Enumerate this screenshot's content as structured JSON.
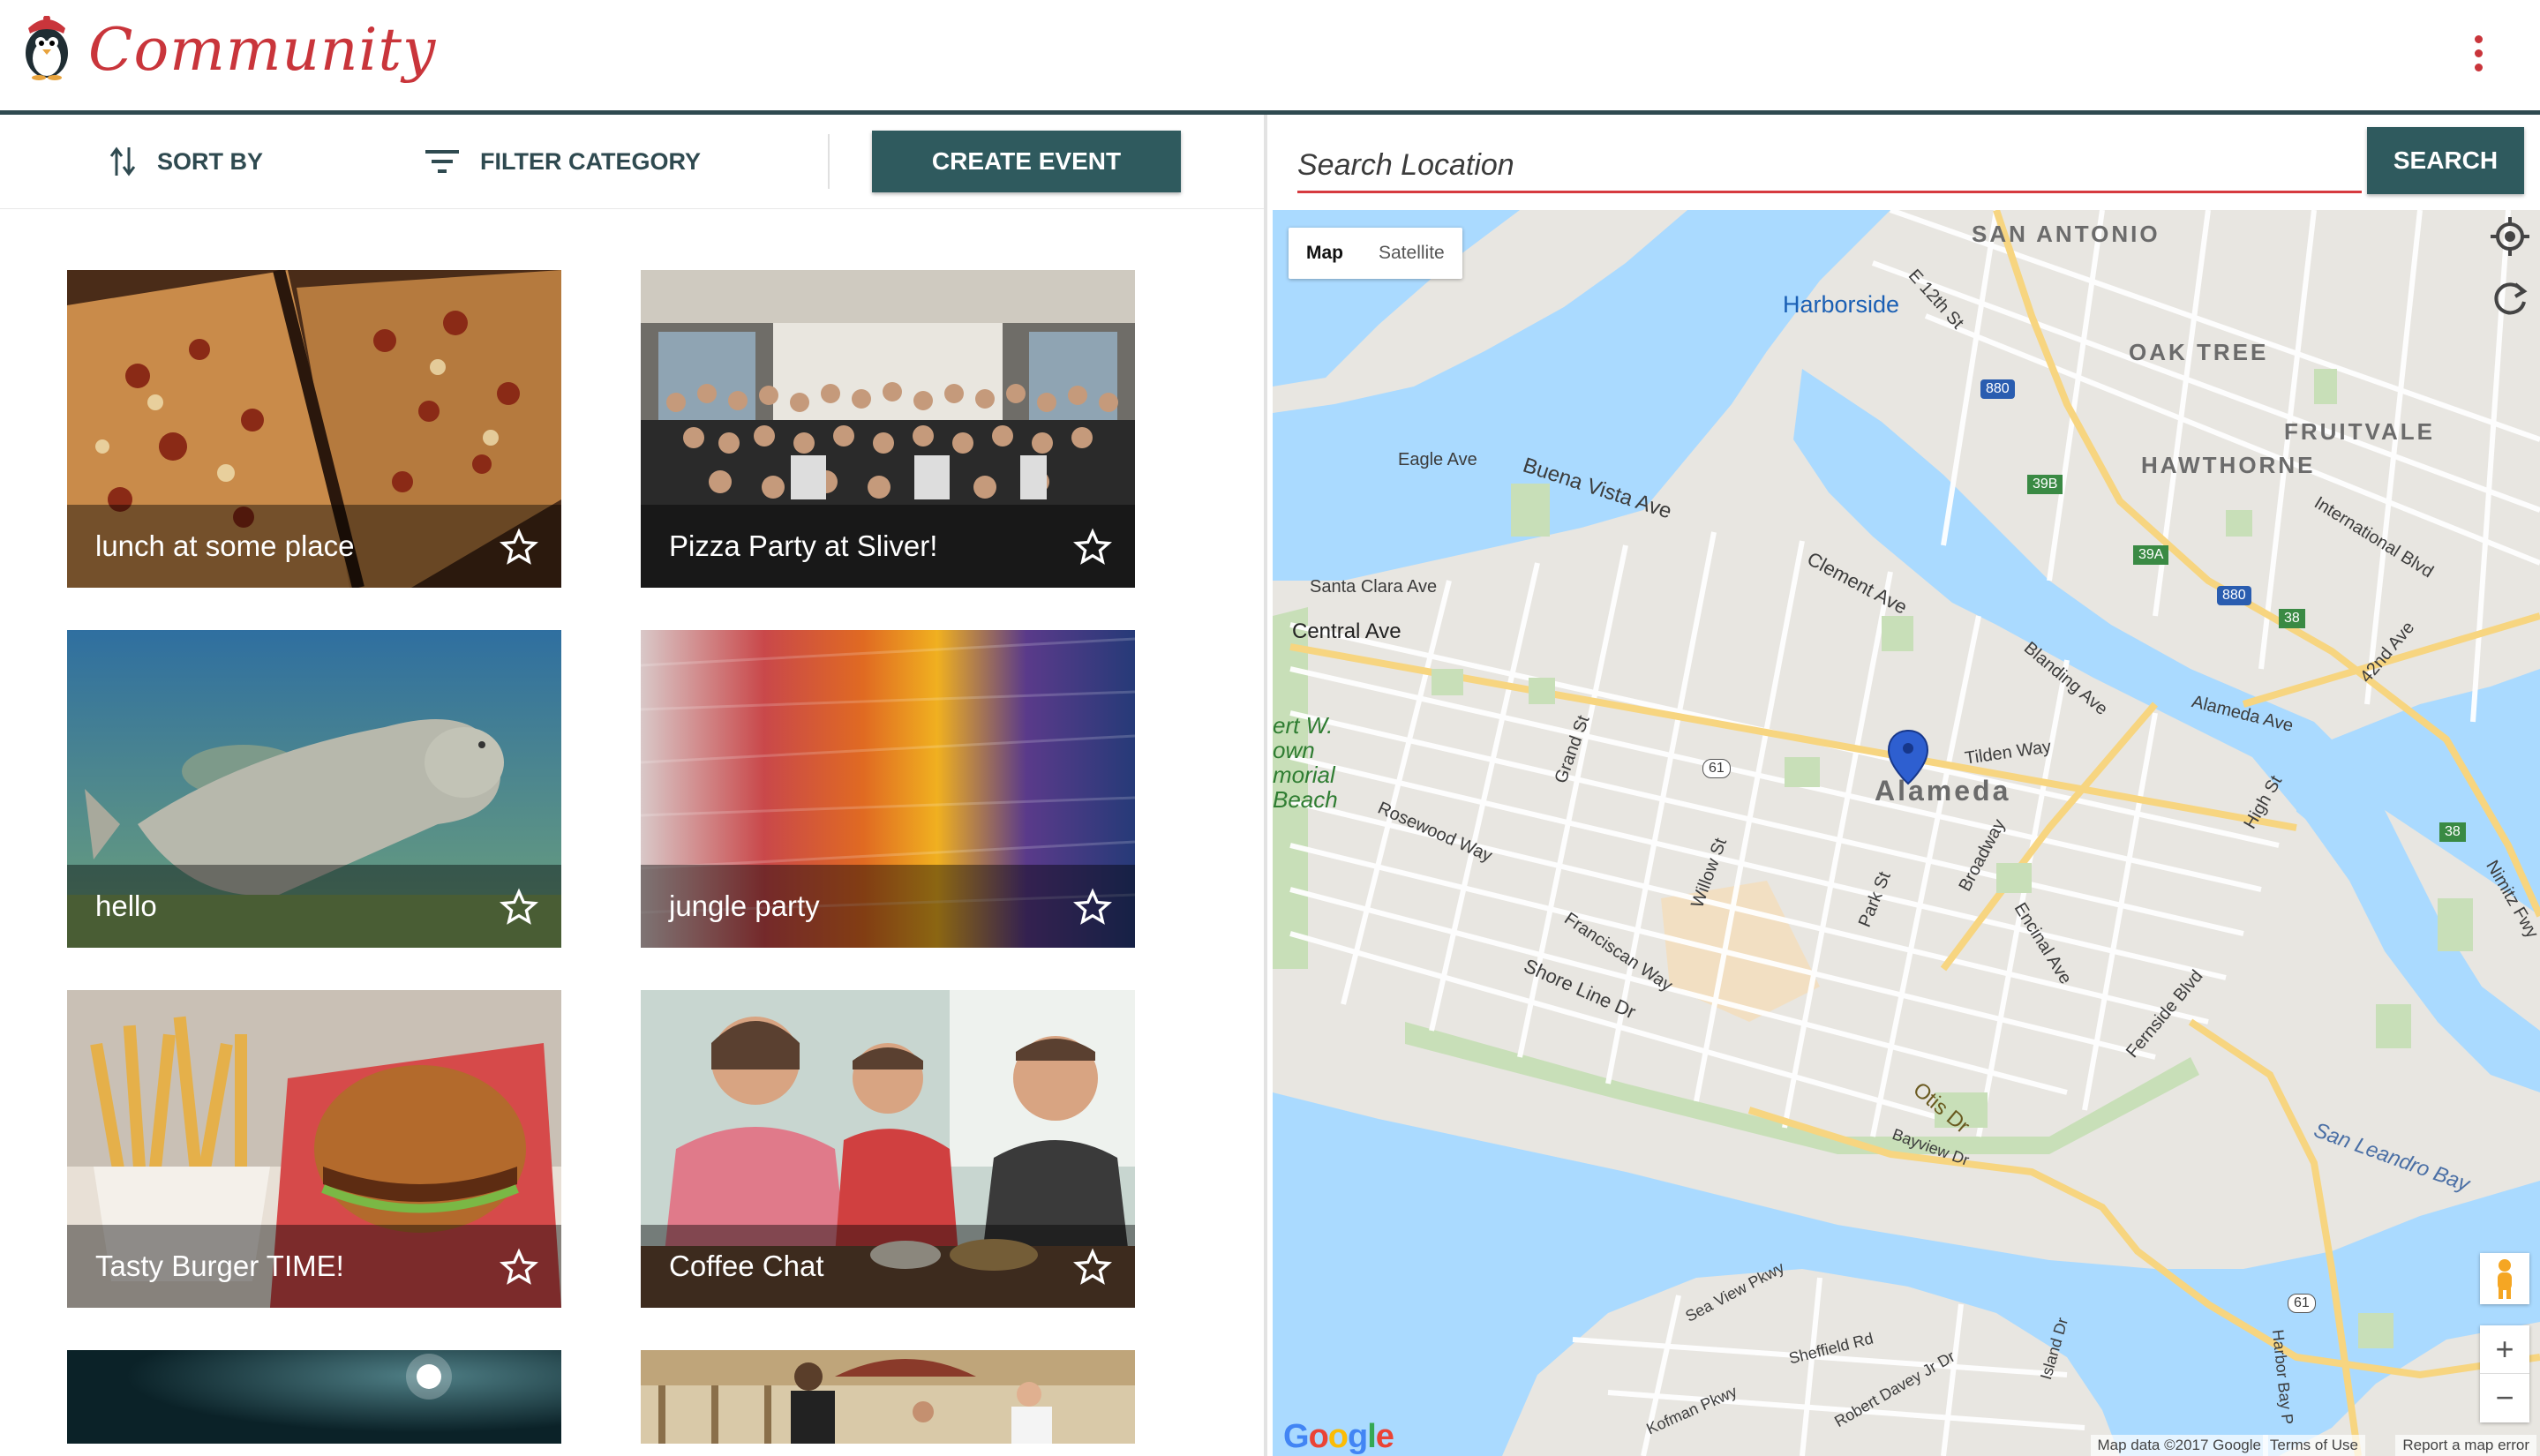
{
  "header": {
    "brand": "Community",
    "logo_icon": "penguin-icon",
    "menu_icon": "more-vert-icon",
    "accent_color": "#c9353b"
  },
  "toolbar": {
    "sort_label": "SORT BY",
    "filter_label": "FILTER CATEGORY",
    "create_label": "CREATE EVENT",
    "button_color": "#2f5a5e"
  },
  "events": [
    {
      "title": "lunch at some place",
      "image": "pizza"
    },
    {
      "title": "Pizza Party at Sliver!",
      "image": "group-photo"
    },
    {
      "title": "hello",
      "image": "manatee"
    },
    {
      "title": "jungle party",
      "image": "abstract-paint"
    },
    {
      "title": "Tasty Burger TIME!",
      "image": "burger-fries"
    },
    {
      "title": "Coffee Chat",
      "image": "friends-cafe"
    },
    {
      "title": "",
      "image": "night-sky"
    },
    {
      "title": "",
      "image": "outdoor-patio"
    }
  ],
  "search": {
    "placeholder": "Search Location",
    "value": "",
    "button_label": "SEARCH"
  },
  "map": {
    "type_options": [
      "Map",
      "Satellite"
    ],
    "selected_type": "Map",
    "labels": {
      "san_antonio": "SAN ANTONIO",
      "oak_tree": "OAK TREE",
      "fruitvale": "FRUITVALE",
      "hawthorne": "HAWTHORNE",
      "harborside": "Harborside",
      "alameda": "Alameda",
      "san_leandro_bay": "San Leandro Bay",
      "central_ave": "Central Ave",
      "buena_vista_ave": "Buena Vista Ave",
      "eagle_ave": "Eagle Ave",
      "santa_clara_ave": "Santa Clara Ave",
      "clement_ave": "Clement Ave",
      "alameda_ave": "Alameda Ave",
      "otis_dr": "Otis Dr",
      "shore_line_dr": "Shore Line Dr",
      "encinal_ave": "Encinal Ave",
      "park_st": "Park St",
      "broadway": "Broadway",
      "fernside_blvd": "Fernside Blvd",
      "high_st": "High St",
      "tilden_way": "Tilden Way",
      "blanding_ave": "Blanding Ave",
      "international_blvd": "International Blvd",
      "42nd_ave": "42nd Ave",
      "nimitz_fwy": "Nimitz Fwy",
      "e_12th_st": "E 12th St",
      "bayview_dr": "Bayview Dr",
      "sea_view_pkwy": "Sea View Pkwy",
      "shefield_rd": "Sheffield Rd",
      "robert_davey_jr_dr": "Robert Davey Jr Dr",
      "kofman_pkwy": "Kofman Pkwy",
      "island_dr": "Island Dr",
      "harbor_bay_pkwy": "Harbor Bay P",
      "franciscan_way": "Franciscan Way",
      "rosewood_way": "Rosewood Way",
      "grand_st": "Grand St",
      "willow_st": "Willow St",
      "beach": "ert W.\nown\nmorial\nBeach"
    },
    "route_shields": [
      "880",
      "880",
      "39B",
      "39A",
      "38",
      "38",
      "61",
      "61"
    ],
    "attribution": {
      "logo": "Google",
      "data": "Map data ©2017 Google",
      "terms": "Terms of Use",
      "report": "Report a map error"
    },
    "controls": {
      "locate_icon": "my-location-icon",
      "refresh_icon": "refresh-icon",
      "pegman_icon": "pegman-icon",
      "zoom_in": "+",
      "zoom_out": "−"
    },
    "marker_icon": "map-pin-icon",
    "water_color": "#aadaff",
    "land_color": "#e8e6e1"
  }
}
